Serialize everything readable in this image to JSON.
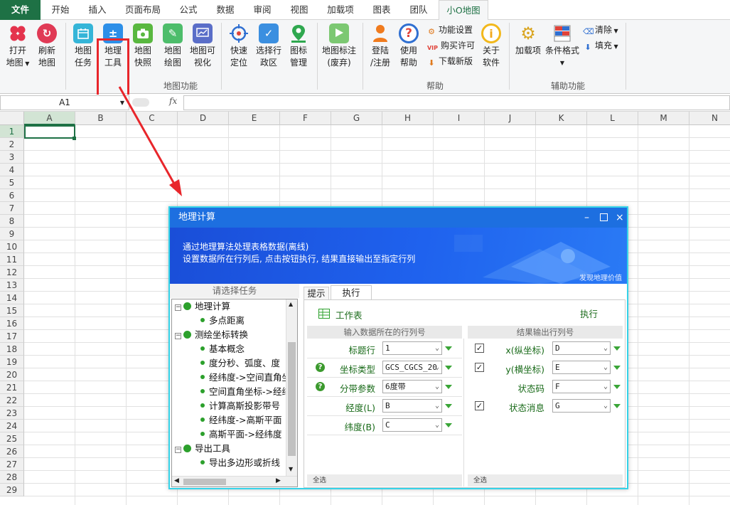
{
  "menu": {
    "tabs": [
      "文件",
      "开始",
      "插入",
      "页面布局",
      "公式",
      "数据",
      "审阅",
      "视图",
      "加载项",
      "图表",
      "团队",
      "小O地图"
    ]
  },
  "ribbon": {
    "buttons": {
      "open_map": {
        "l1": "打开",
        "l2": "地图"
      },
      "refresh_map": {
        "l1": "刷新",
        "l2": "地图"
      },
      "map_task": {
        "l1": "地图",
        "l2": "任务"
      },
      "geo_tools": {
        "l1": "地理",
        "l2": "工具"
      },
      "map_snapshot": {
        "l1": "地图",
        "l2": "快照"
      },
      "map_draw": {
        "l1": "地图",
        "l2": "绘图"
      },
      "map_viz": {
        "l1": "地图可",
        "l2": "视化"
      },
      "quick_locate": {
        "l1": "快速",
        "l2": "定位"
      },
      "select_region": {
        "l1": "选择行",
        "l2": "政区"
      },
      "icon_mgmt": {
        "l1": "图标",
        "l2": "管理"
      },
      "map_mark": {
        "l1": "地图标注",
        "l2": "(废弃)"
      },
      "login": {
        "l1": "登陆",
        "l2": "/注册"
      },
      "help": {
        "l1": "使用",
        "l2": "帮助"
      },
      "about": {
        "l1": "关于",
        "l2": "软件"
      },
      "addins": {
        "l1": "加载项"
      },
      "cond_format": {
        "l1": "条件格式"
      }
    },
    "small": {
      "settings": "功能设置",
      "buy": "购买许可",
      "vip": "VIP",
      "download": "下载新版",
      "clear": "清除",
      "fill": "填充"
    },
    "groups": {
      "map": "地图功能",
      "help": "帮助",
      "aux": "辅助功能"
    }
  },
  "formula_bar": {
    "name_box": "A1",
    "fx": "fx",
    "value": ""
  },
  "sheet": {
    "columns": [
      "A",
      "B",
      "C",
      "D",
      "E",
      "F",
      "G",
      "H",
      "I",
      "J",
      "K",
      "L",
      "M",
      "N"
    ],
    "rows": [
      "1",
      "2",
      "3",
      "4",
      "5",
      "6",
      "7",
      "8",
      "9",
      "10",
      "11",
      "12",
      "13",
      "14",
      "15",
      "16",
      "17",
      "18",
      "19",
      "20",
      "21",
      "22",
      "23",
      "24",
      "25",
      "26",
      "27",
      "28",
      "29"
    ],
    "selected_cell": "A1"
  },
  "dialog": {
    "title": "地理计算",
    "banner_line1": "通过地理算法处理表格数据(离线)",
    "banner_line2": "设置数据所在行列后, 点击按钮执行, 结果直接输出至指定行列",
    "banner_tag": "发现地理价值",
    "left_header": "请选择任务",
    "tree": [
      {
        "label": "地理计算",
        "level": 0
      },
      {
        "label": "多点距离",
        "level": 1
      },
      {
        "label": "测绘坐标转换",
        "level": 0
      },
      {
        "label": "基本概念",
        "level": 1
      },
      {
        "label": "度分秒、弧度、度",
        "level": 1
      },
      {
        "label": "经纬度->空间直角坐",
        "level": 1
      },
      {
        "label": "空间直角坐标->经纬",
        "level": 1
      },
      {
        "label": "计算高斯投影带号",
        "level": 1
      },
      {
        "label": "经纬度->高斯平面",
        "level": 1
      },
      {
        "label": "高斯平面->经纬度",
        "level": 1
      },
      {
        "label": "导出工具",
        "level": 0
      },
      {
        "label": "导出多边形或折线",
        "level": 1
      }
    ],
    "tabs": {
      "hint": "提示",
      "exec": "执行"
    },
    "worksheet_label": "工作表",
    "exec_button": "执行",
    "input_header": "输入数据所在的行列号",
    "output_header": "结果输出行列号",
    "inputs": [
      {
        "label": "标题行",
        "value": "1",
        "help": false
      },
      {
        "label": "坐标类型",
        "value": "GCS_CGCS_20",
        "help": true
      },
      {
        "label": "分带参数",
        "value": "6度带",
        "help": true
      },
      {
        "label": "经度(L)",
        "value": "B",
        "help": false
      },
      {
        "label": "纬度(B)",
        "value": "C",
        "help": false
      }
    ],
    "outputs": [
      {
        "label": "x(纵坐标)",
        "value": "D",
        "checked": true
      },
      {
        "label": "y(横坐标)",
        "value": "E",
        "checked": true
      },
      {
        "label": "状态码",
        "value": "F",
        "checked": false
      },
      {
        "label": "状态消息",
        "value": "G",
        "checked": true
      }
    ],
    "select_all_left": "全选",
    "select_all_right": "全选"
  },
  "colors": {
    "excel_green": "#1e7145",
    "dialog_blue": "#1d6fe0",
    "highlight_red": "#e8262b",
    "dialog_border": "#35d3e8"
  }
}
